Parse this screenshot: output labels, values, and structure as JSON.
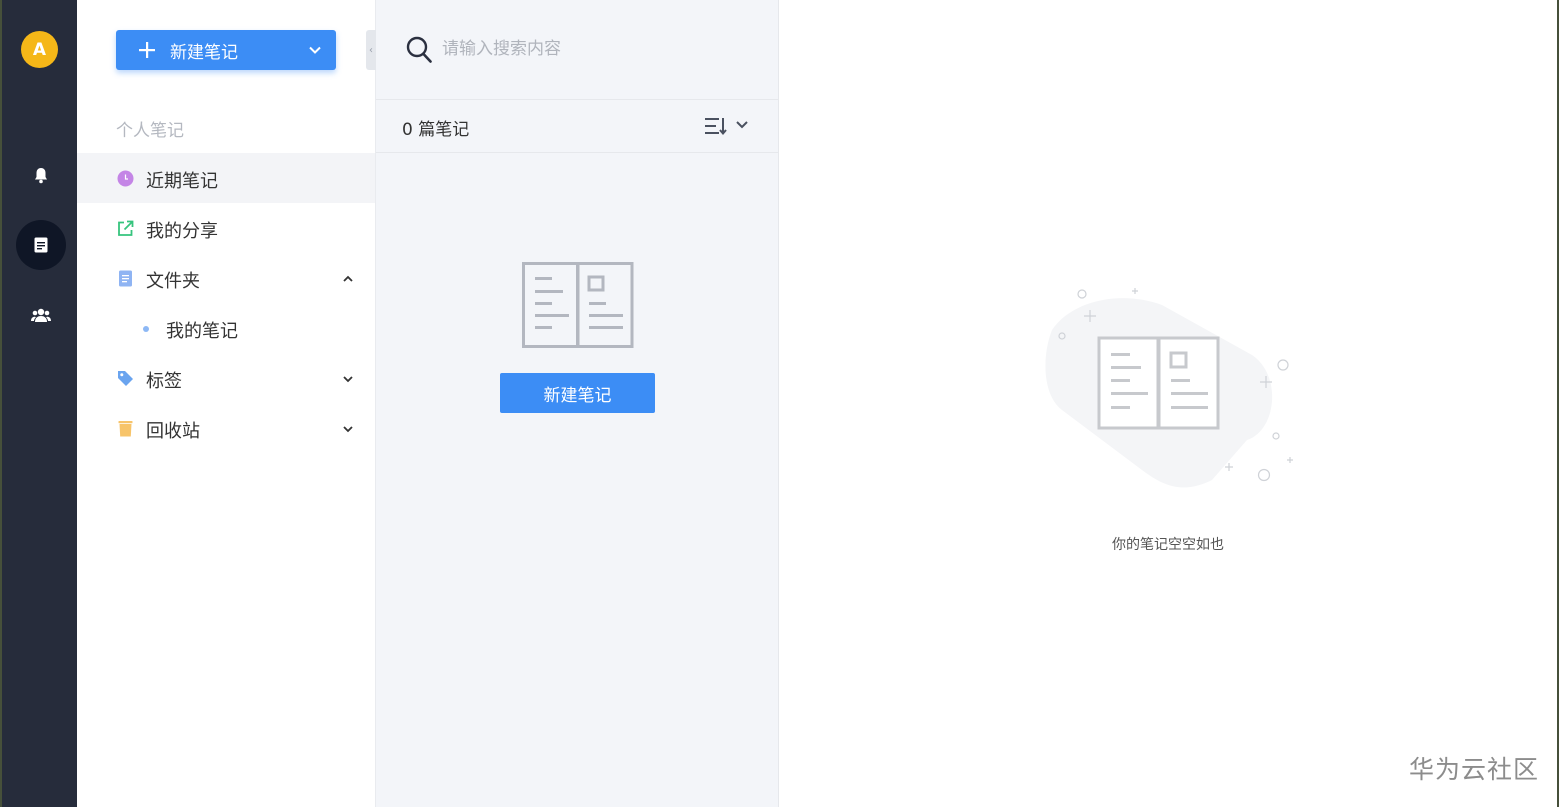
{
  "rail": {
    "avatar_letter": "A",
    "items": [
      {
        "icon": "bell-icon"
      },
      {
        "icon": "note-icon",
        "active": true
      },
      {
        "icon": "team-icon"
      }
    ]
  },
  "sidebar": {
    "new_button_label": "新建笔记",
    "section_title": "个人笔记",
    "items": [
      {
        "label": "近期笔记",
        "icon": "clock-icon",
        "active": true
      },
      {
        "label": "我的分享",
        "icon": "share-icon"
      },
      {
        "label": "文件夹",
        "icon": "folder-doc-icon",
        "expanded": true
      },
      {
        "label": "我的笔记",
        "sub": true
      },
      {
        "label": "标签",
        "icon": "tag-icon",
        "expanded": false
      },
      {
        "label": "回收站",
        "icon": "trash-icon",
        "expanded": false
      }
    ]
  },
  "note_list": {
    "search_placeholder": "请输入搜索内容",
    "count_label": "0 篇笔记",
    "empty_new_button": "新建笔记"
  },
  "main": {
    "empty_message": "你的笔记空空如也"
  },
  "watermark": "华为云社区",
  "colors": {
    "rail_bg": "#262c3b",
    "accent": "#3c8df5",
    "avatar": "#f5b718",
    "list_bg": "#f3f5f9"
  }
}
